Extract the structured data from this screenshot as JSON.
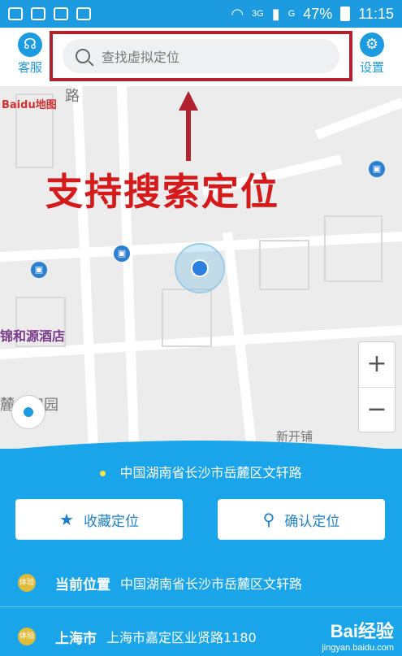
{
  "status_bar": {
    "network": "3G",
    "signal_label": "G",
    "battery": "47%",
    "time": "11:15"
  },
  "topbar": {
    "service_label": "客服",
    "settings_label": "设置",
    "search_placeholder": "查找虚拟定位"
  },
  "map": {
    "brand_logo": "Baidu地图",
    "road_label": "路",
    "hotel_label": "锦和源酒店",
    "garden_label": "麓山和园",
    "area_label": "新开铺",
    "caption": "支持搜索定位",
    "zoom_in": "+",
    "zoom_out": "−"
  },
  "panel": {
    "current_address": "中国湖南省长沙市岳麓区文轩路",
    "favorite_button": "收藏定位",
    "confirm_button": "确认定位",
    "rows": [
      {
        "tag": "体验",
        "name": "当前位置",
        "address": "中国湖南省长沙市岳麓区文轩路"
      },
      {
        "tag": "体验",
        "name": "上海市",
        "address": "上海市嘉定区业贤路1180"
      }
    ]
  },
  "watermark": {
    "logo": "Bai经验",
    "site": "jingyan.baidu.com"
  },
  "colors": {
    "primary": "#1d9be0",
    "annotation_red": "#b2222e",
    "caption_red": "#d41a1a"
  }
}
